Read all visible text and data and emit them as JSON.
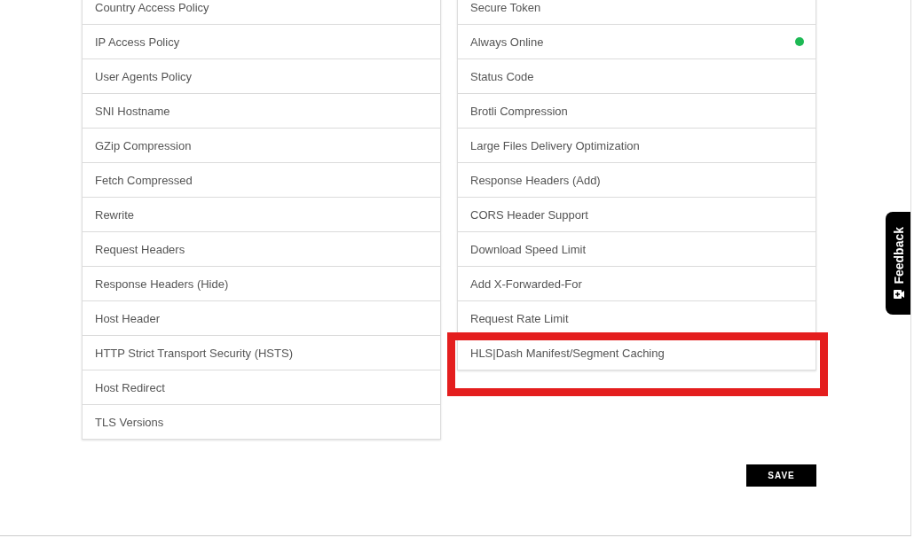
{
  "left_list": [
    {
      "label": "Country Access Policy",
      "active": false,
      "highlighted": false
    },
    {
      "label": "IP Access Policy",
      "active": false,
      "highlighted": false
    },
    {
      "label": "User Agents Policy",
      "active": false,
      "highlighted": false
    },
    {
      "label": "SNI Hostname",
      "active": false,
      "highlighted": false
    },
    {
      "label": "GZip Compression",
      "active": false,
      "highlighted": false
    },
    {
      "label": "Fetch Compressed",
      "active": false,
      "highlighted": false
    },
    {
      "label": "Rewrite",
      "active": false,
      "highlighted": false
    },
    {
      "label": "Request Headers",
      "active": false,
      "highlighted": false
    },
    {
      "label": "Response Headers (Hide)",
      "active": false,
      "highlighted": false
    },
    {
      "label": "Host Header",
      "active": false,
      "highlighted": false
    },
    {
      "label": "HTTP Strict Transport Security (HSTS)",
      "active": false,
      "highlighted": false
    },
    {
      "label": "Host Redirect",
      "active": false,
      "highlighted": false
    },
    {
      "label": "TLS Versions",
      "active": false,
      "highlighted": false
    }
  ],
  "right_list": [
    {
      "label": "Secure Token",
      "active": false,
      "highlighted": false
    },
    {
      "label": "Always Online",
      "active": true,
      "highlighted": false
    },
    {
      "label": "Status Code",
      "active": false,
      "highlighted": false
    },
    {
      "label": "Brotli Compression",
      "active": false,
      "highlighted": false
    },
    {
      "label": "Large Files Delivery Optimization",
      "active": false,
      "highlighted": false
    },
    {
      "label": "Response Headers (Add)",
      "active": false,
      "highlighted": false
    },
    {
      "label": "CORS Header Support",
      "active": false,
      "highlighted": false
    },
    {
      "label": "Download Speed Limit",
      "active": false,
      "highlighted": false
    },
    {
      "label": "Add X-Forwarded-For",
      "active": false,
      "highlighted": false
    },
    {
      "label": "Request Rate Limit",
      "active": false,
      "highlighted": false
    },
    {
      "label": "HLS|Dash Manifest/Segment Caching",
      "active": false,
      "highlighted": true
    }
  ],
  "save_button": "SAVE",
  "feedback_tab": "Feedback"
}
